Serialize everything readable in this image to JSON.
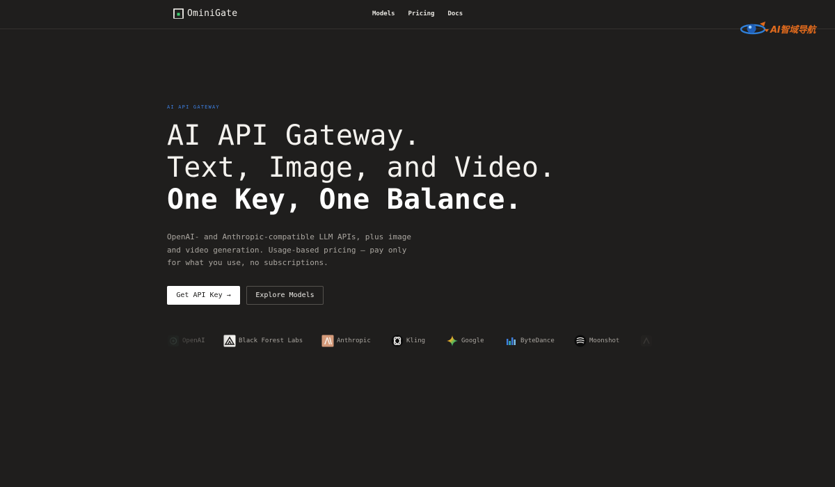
{
  "brand": {
    "name": "OminiGate"
  },
  "nav": {
    "models": "Models",
    "pricing": "Pricing",
    "docs": "Docs"
  },
  "watermark": {
    "text": "AI智域导航"
  },
  "hero": {
    "eyebrow": "AI API GATEWAY",
    "headline": {
      "line1": "AI API Gateway.",
      "line2": "Text, Image, and Video.",
      "line3": "One Key, One Balance."
    },
    "subtitle": "OpenAI- and Anthropic-compatible LLM APIs, plus image and video generation. Usage-based pricing — pay only for what you use, no subscriptions.",
    "primary_cta": "Get API Key →",
    "secondary_cta": "Explore Models"
  },
  "providers": [
    {
      "name": "OpenAI",
      "icon": "openai-icon"
    },
    {
      "name": "Black Forest Labs",
      "icon": "black-forest-labs-icon"
    },
    {
      "name": "Anthropic",
      "icon": "anthropic-icon"
    },
    {
      "name": "Kling",
      "icon": "kling-icon"
    },
    {
      "name": "Google",
      "icon": "google-icon"
    },
    {
      "name": "ByteDance",
      "icon": "bytedance-icon"
    },
    {
      "name": "Moonshot",
      "icon": "moonshot-icon"
    },
    {
      "name": "",
      "icon": "partial-provider-icon"
    }
  ],
  "colors": {
    "background": "#1f1e1d",
    "accent_eyebrow": "#3d7fe0",
    "brand_icon_green": "#3ecf6e",
    "anthropic_tile": "#d49a7a"
  }
}
